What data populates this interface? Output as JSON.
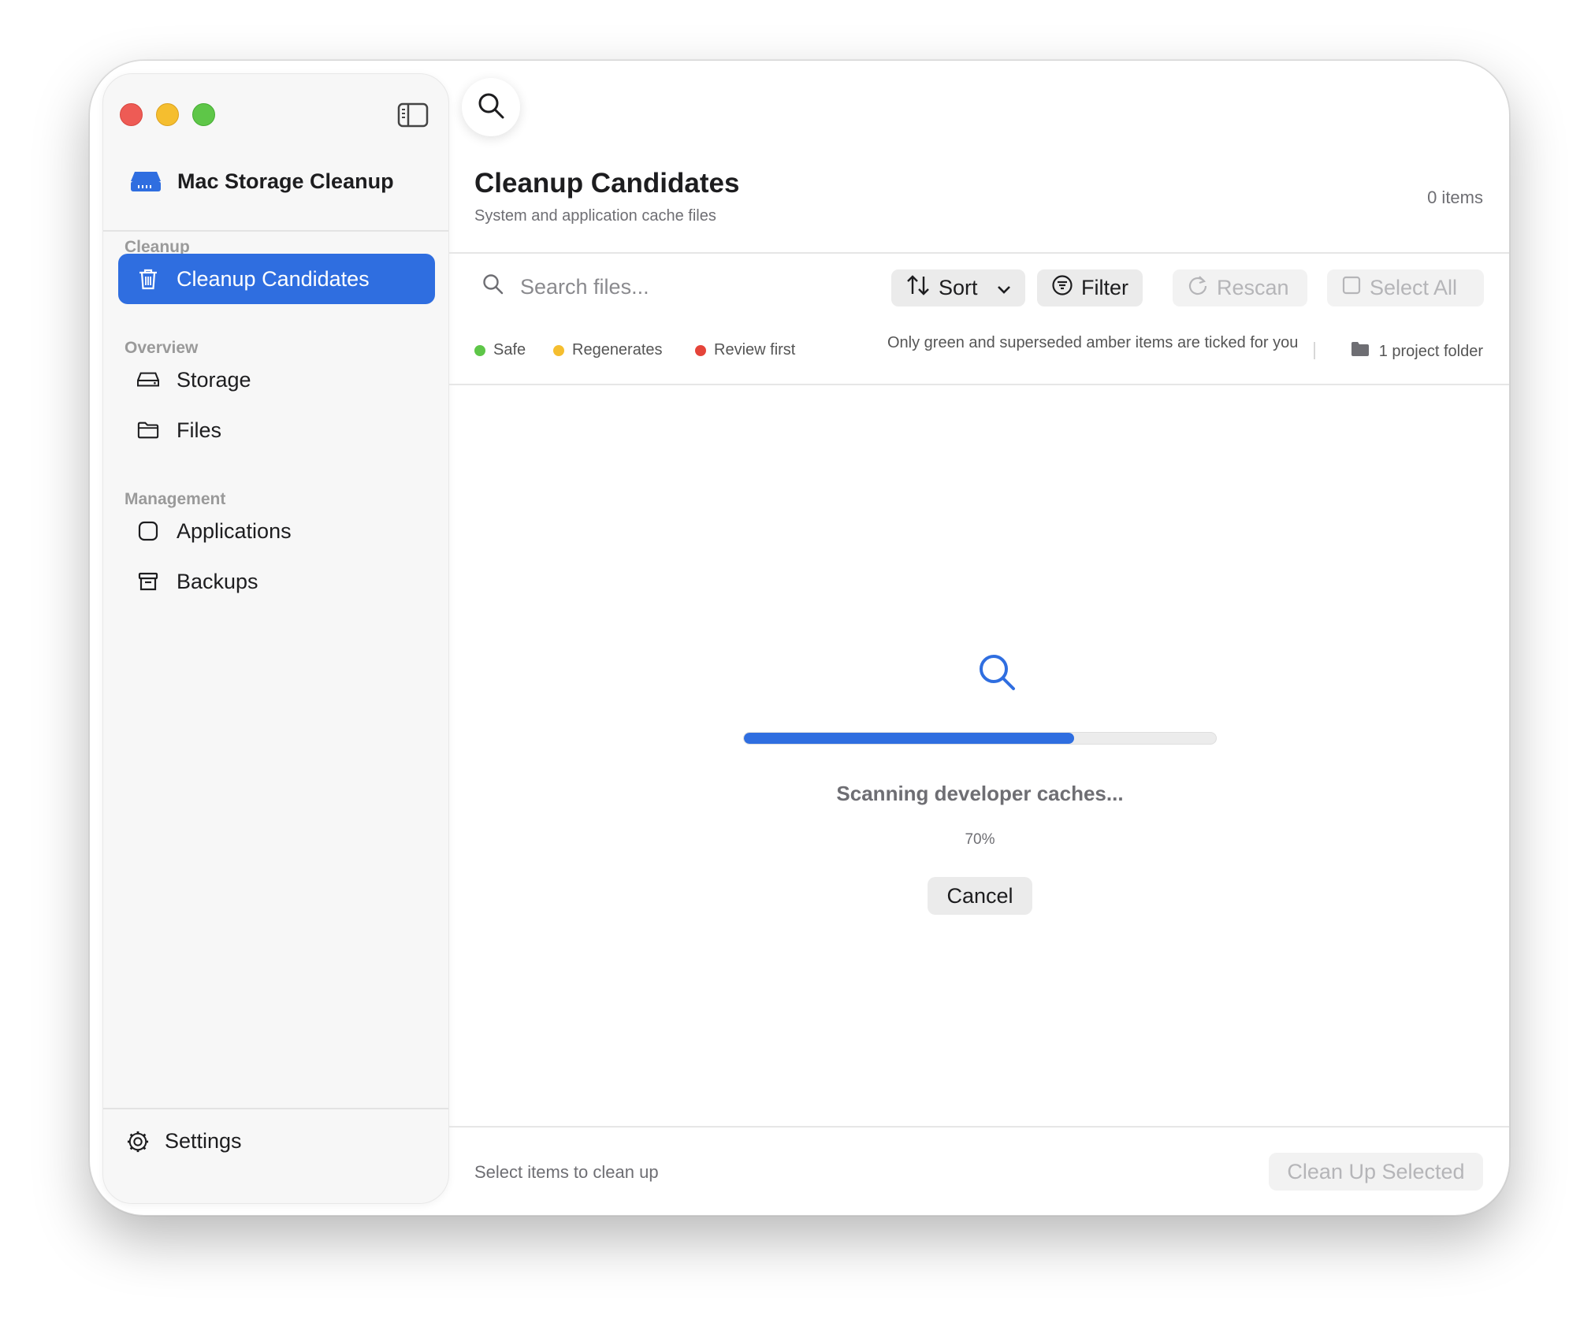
{
  "app": {
    "title": "Mac Storage Cleanup",
    "accent_color": "#2f6ee0"
  },
  "sidebar": {
    "sections": [
      {
        "label": "Cleanup"
      },
      {
        "label": "Overview"
      },
      {
        "label": "Management"
      }
    ],
    "items": [
      {
        "label": "Cleanup Candidates",
        "icon": "trash-icon",
        "active": true
      },
      {
        "label": "Storage",
        "icon": "drive-icon",
        "active": false
      },
      {
        "label": "Files",
        "icon": "folder-icon",
        "active": false
      },
      {
        "label": "Applications",
        "icon": "app-icon",
        "active": false
      },
      {
        "label": "Backups",
        "icon": "archive-icon",
        "active": false
      }
    ],
    "settings_label": "Settings"
  },
  "main": {
    "title": "Cleanup Candidates",
    "subtitle": "System and application cache files",
    "item_count": "0 items"
  },
  "toolbar": {
    "search_placeholder": "Search files...",
    "sort_label": "Sort",
    "filter_label": "Filter",
    "rescan_label": "Rescan",
    "select_all_label": "Select All"
  },
  "legend": {
    "items": [
      {
        "label": "Safe",
        "color": "#5ec648"
      },
      {
        "label": "Regenerates",
        "color": "#f5be2f"
      },
      {
        "label": "Review first",
        "color": "#e5443a"
      }
    ],
    "note": "Only green and superseded amber items are ticked for you",
    "project_folder": "1 project folder"
  },
  "scan": {
    "status": "Scanning developer caches...",
    "percent_text": "70%",
    "progress": 0.7,
    "cancel_label": "Cancel"
  },
  "footer": {
    "status": "Select items to clean up",
    "cleanup_label": "Clean Up Selected"
  }
}
